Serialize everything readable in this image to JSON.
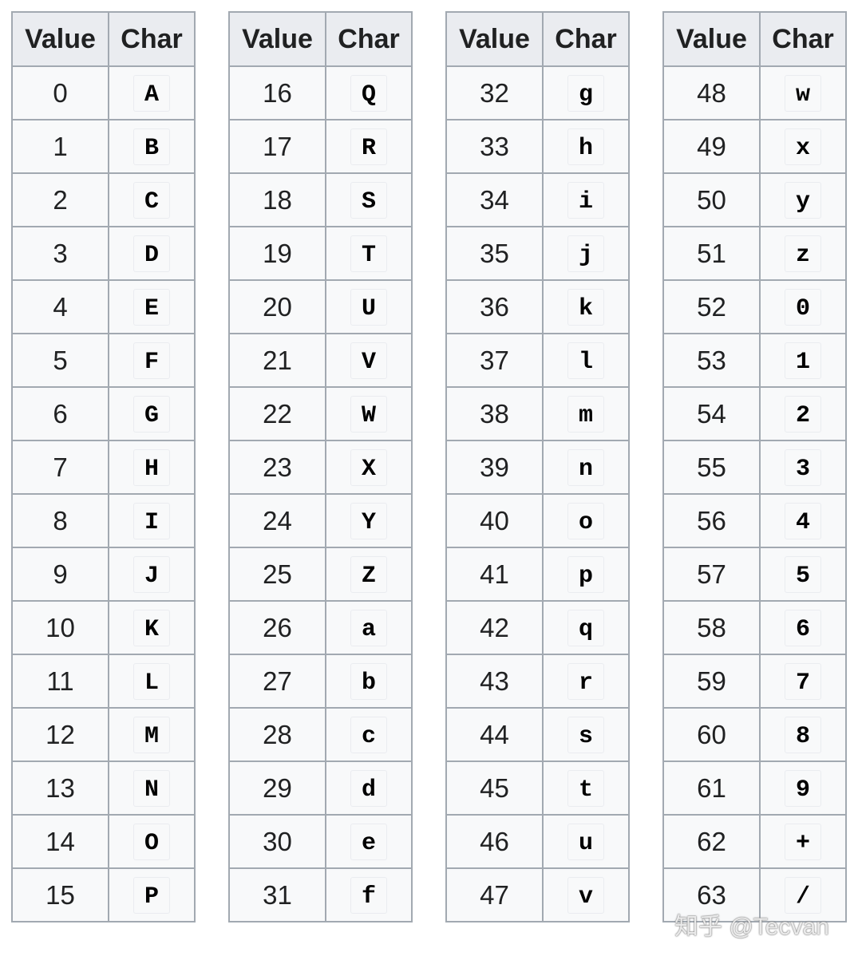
{
  "headers": {
    "value": "Value",
    "char": "Char"
  },
  "tables": [
    {
      "rows": [
        [
          "0",
          "A"
        ],
        [
          "1",
          "B"
        ],
        [
          "2",
          "C"
        ],
        [
          "3",
          "D"
        ],
        [
          "4",
          "E"
        ],
        [
          "5",
          "F"
        ],
        [
          "6",
          "G"
        ],
        [
          "7",
          "H"
        ],
        [
          "8",
          "I"
        ],
        [
          "9",
          "J"
        ],
        [
          "10",
          "K"
        ],
        [
          "11",
          "L"
        ],
        [
          "12",
          "M"
        ],
        [
          "13",
          "N"
        ],
        [
          "14",
          "O"
        ],
        [
          "15",
          "P"
        ]
      ]
    },
    {
      "rows": [
        [
          "16",
          "Q"
        ],
        [
          "17",
          "R"
        ],
        [
          "18",
          "S"
        ],
        [
          "19",
          "T"
        ],
        [
          "20",
          "U"
        ],
        [
          "21",
          "V"
        ],
        [
          "22",
          "W"
        ],
        [
          "23",
          "X"
        ],
        [
          "24",
          "Y"
        ],
        [
          "25",
          "Z"
        ],
        [
          "26",
          "a"
        ],
        [
          "27",
          "b"
        ],
        [
          "28",
          "c"
        ],
        [
          "29",
          "d"
        ],
        [
          "30",
          "e"
        ],
        [
          "31",
          "f"
        ]
      ]
    },
    {
      "rows": [
        [
          "32",
          "g"
        ],
        [
          "33",
          "h"
        ],
        [
          "34",
          "i"
        ],
        [
          "35",
          "j"
        ],
        [
          "36",
          "k"
        ],
        [
          "37",
          "l"
        ],
        [
          "38",
          "m"
        ],
        [
          "39",
          "n"
        ],
        [
          "40",
          "o"
        ],
        [
          "41",
          "p"
        ],
        [
          "42",
          "q"
        ],
        [
          "43",
          "r"
        ],
        [
          "44",
          "s"
        ],
        [
          "45",
          "t"
        ],
        [
          "46",
          "u"
        ],
        [
          "47",
          "v"
        ]
      ]
    },
    {
      "rows": [
        [
          "48",
          "w"
        ],
        [
          "49",
          "x"
        ],
        [
          "50",
          "y"
        ],
        [
          "51",
          "z"
        ],
        [
          "52",
          "0"
        ],
        [
          "53",
          "1"
        ],
        [
          "54",
          "2"
        ],
        [
          "55",
          "3"
        ],
        [
          "56",
          "4"
        ],
        [
          "57",
          "5"
        ],
        [
          "58",
          "6"
        ],
        [
          "59",
          "7"
        ],
        [
          "60",
          "8"
        ],
        [
          "61",
          "9"
        ],
        [
          "62",
          "+"
        ],
        [
          "63",
          "/"
        ]
      ]
    }
  ],
  "watermark": "知乎 @Tecvan"
}
